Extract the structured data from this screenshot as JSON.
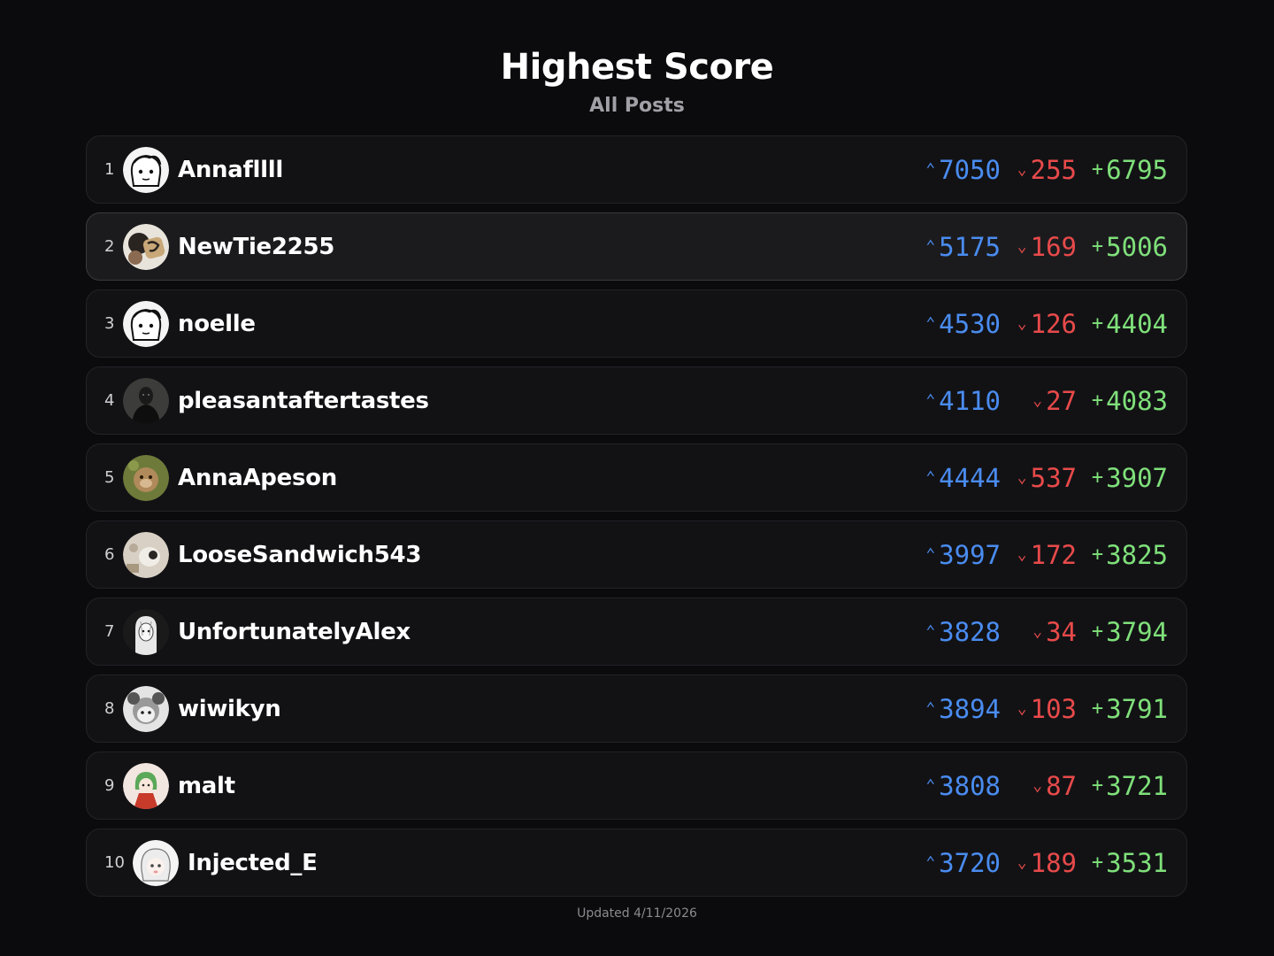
{
  "header": {
    "title": "Highest Score",
    "subtitle": "All Posts"
  },
  "glyphs": {
    "up": "⌃",
    "down": "⌄",
    "net": "+"
  },
  "colors": {
    "up": "#4a8cf0",
    "down": "#e84a4a",
    "net": "#7fe07a",
    "background": "#0b0b0d"
  },
  "rows": [
    {
      "rank": "1",
      "name": "Annafllll",
      "up": "7050",
      "down": "255",
      "net": "6795"
    },
    {
      "rank": "2",
      "name": "NewTie2255",
      "up": "5175",
      "down": "169",
      "net": "5006"
    },
    {
      "rank": "3",
      "name": "noelle",
      "up": "4530",
      "down": "126",
      "net": "4404"
    },
    {
      "rank": "4",
      "name": "pleasantaftertastes",
      "up": "4110",
      "down": "27",
      "net": "4083"
    },
    {
      "rank": "5",
      "name": "AnnaApeson",
      "up": "4444",
      "down": "537",
      "net": "3907"
    },
    {
      "rank": "6",
      "name": "LooseSandwich543",
      "up": "3997",
      "down": "172",
      "net": "3825"
    },
    {
      "rank": "7",
      "name": "UnfortunatelyAlex",
      "up": "3828",
      "down": "34",
      "net": "3794"
    },
    {
      "rank": "8",
      "name": "wiwikyn",
      "up": "3894",
      "down": "103",
      "net": "3791"
    },
    {
      "rank": "9",
      "name": "malt",
      "up": "3808",
      "down": "87",
      "net": "3721"
    },
    {
      "rank": "10",
      "name": "Injected_E",
      "up": "3720",
      "down": "189",
      "net": "3531"
    }
  ],
  "footer": {
    "updated": "Updated 4/11/2026"
  }
}
